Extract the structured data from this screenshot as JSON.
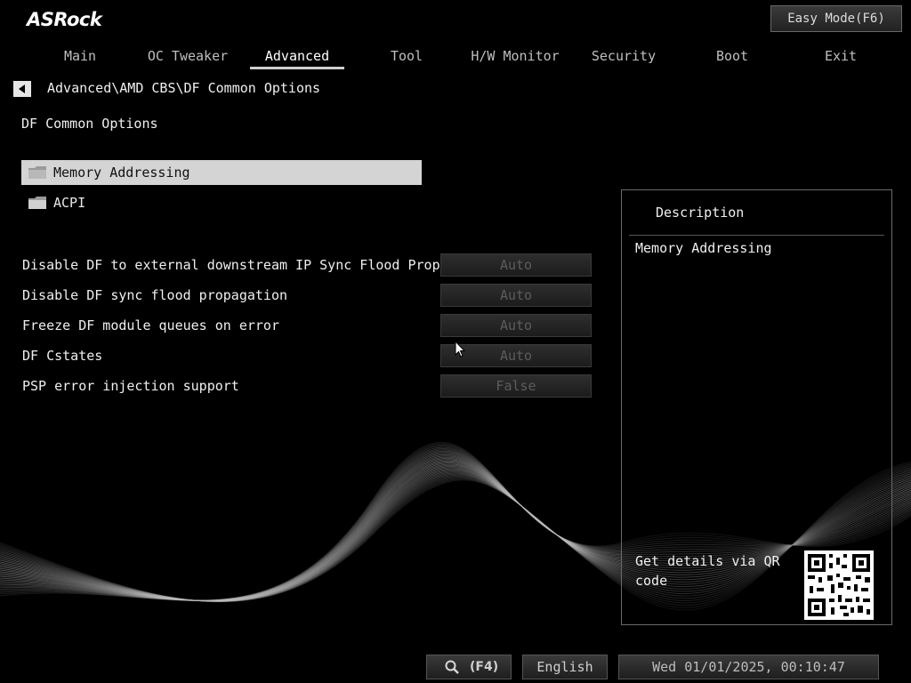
{
  "brand": {
    "logo_text": "ASRock"
  },
  "header": {
    "easy_mode_label": "Easy Mode(F6)"
  },
  "tabs": [
    {
      "label": "Main"
    },
    {
      "label": "OC Tweaker"
    },
    {
      "label": "Advanced",
      "active": true
    },
    {
      "label": "Tool"
    },
    {
      "label": "H/W Monitor"
    },
    {
      "label": "Security"
    },
    {
      "label": "Boot"
    },
    {
      "label": "Exit"
    }
  ],
  "breadcrumb": "Advanced\\AMD CBS\\DF Common Options",
  "page_title": "DF Common Options",
  "submenus": [
    {
      "label": "Memory Addressing",
      "selected": true
    },
    {
      "label": "ACPI",
      "selected": false
    }
  ],
  "options": [
    {
      "label": "Disable DF to external downstream IP Sync Flood Prop...",
      "value": "Auto"
    },
    {
      "label": "Disable DF sync flood propagation",
      "value": "Auto"
    },
    {
      "label": "Freeze DF module queues on error",
      "value": "Auto"
    },
    {
      "label": "DF Cstates",
      "value": "Auto"
    },
    {
      "label": "PSP error injection support",
      "value": "False"
    }
  ],
  "description": {
    "title": "Description",
    "text": "Memory Addressing",
    "qr_text": "Get details via QR code"
  },
  "footer": {
    "search_key": "(F4)",
    "language": "English",
    "datetime": "Wed 01/01/2025, 00:10:47"
  },
  "colors": {
    "selected_row": "#d4d4d4",
    "disabled_value": "#5c5c5c",
    "background": "#000000"
  }
}
